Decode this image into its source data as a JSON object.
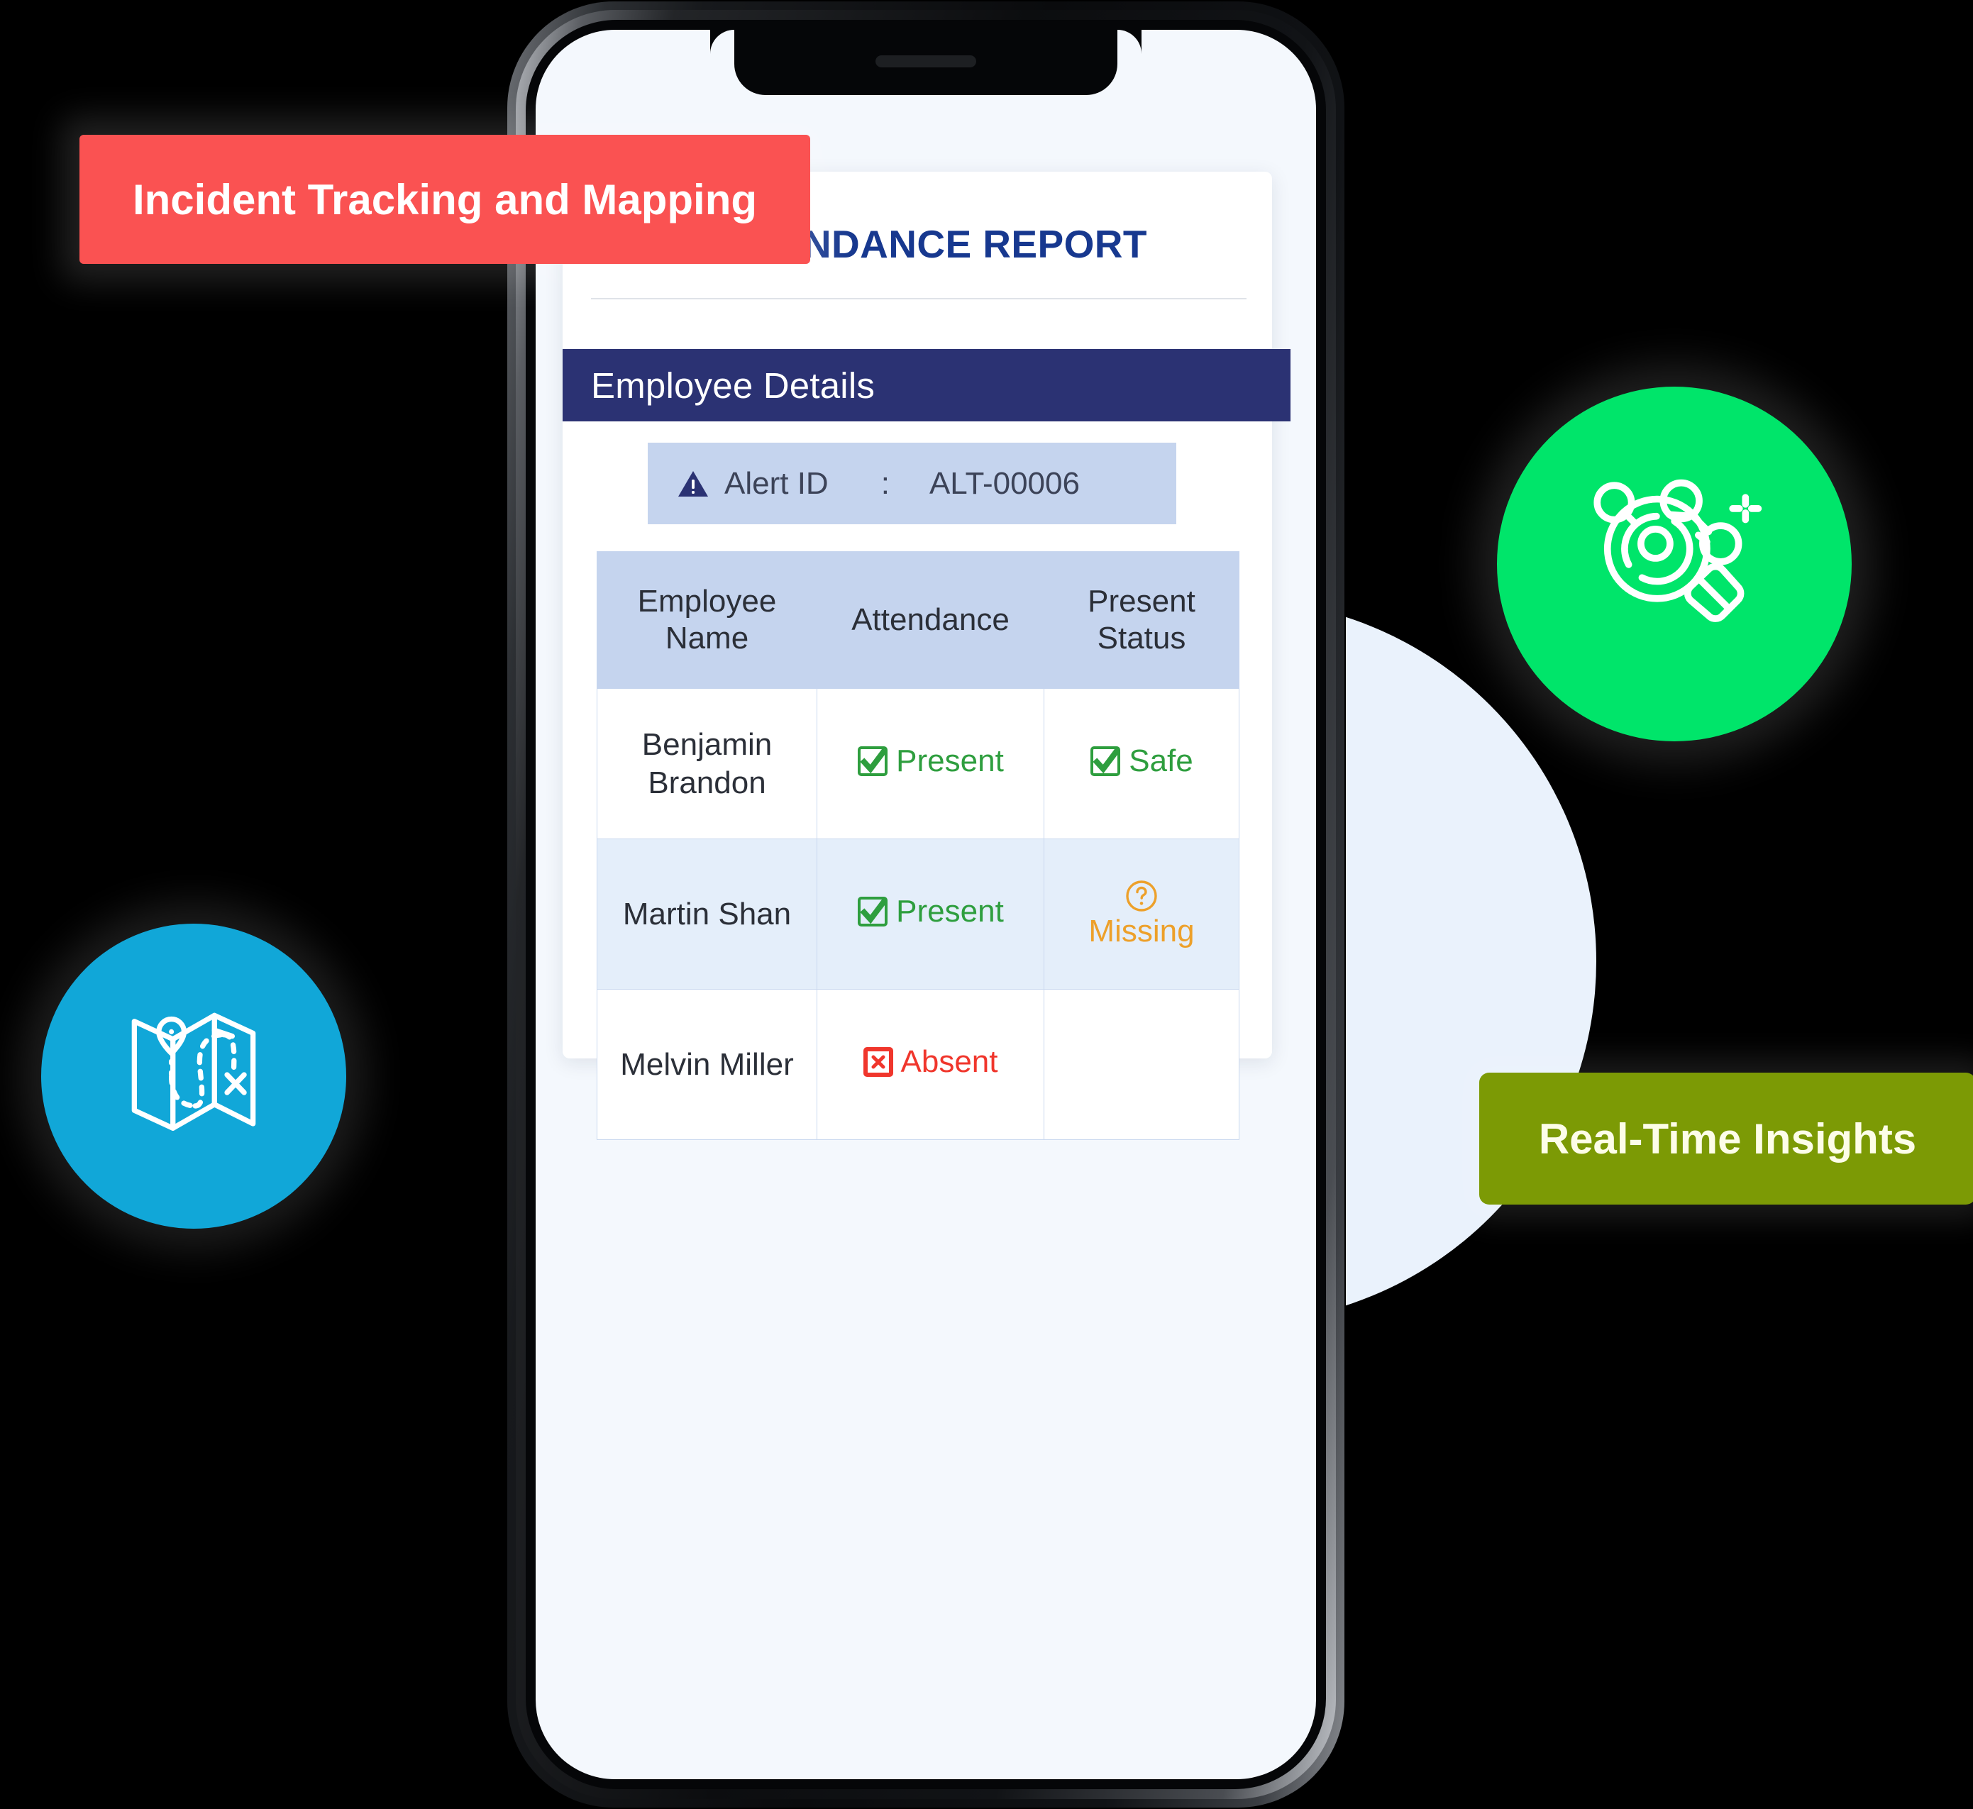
{
  "badges": {
    "incident": {
      "label": "Incident Tracking and Mapping",
      "color": "#fa5252"
    },
    "insights": {
      "label": "Real-Time Insights",
      "color": "#7c9a05"
    }
  },
  "chips": {
    "map": {
      "icon": "folded-map-route-icon",
      "color": "#11a7d8"
    },
    "insight": {
      "icon": "network-analysis-magnifier-icon",
      "color": "#00e56a"
    }
  },
  "phone": {
    "screen_background": "#f4f8fd",
    "frame_color": "#050608"
  },
  "app": {
    "page_title": "VIEW ATTENDANCE REPORT",
    "title_color": "#17388f",
    "section": {
      "label": "Employee Details",
      "background": "#2b3273"
    },
    "alert": {
      "icon": "warning-triangle-icon",
      "label": "Alert ID",
      "separator": ":",
      "value": "ALT-00006",
      "background": "#c5d4ee"
    },
    "table": {
      "header_background": "#c5d4ee",
      "row_alt_background": "#e4eefa",
      "columns": [
        "Employee Name",
        "Attendance",
        "Present Status"
      ],
      "rows": [
        {
          "name": "Benjamin Brandon",
          "attendance": {
            "text": "Present",
            "icon": "checkbox-checked-icon",
            "color": "#2e9e3e"
          },
          "status": {
            "text": "Safe",
            "icon": "checkbox-checked-icon",
            "color": "#2e9e3e"
          }
        },
        {
          "name": "Martin Shan",
          "attendance": {
            "text": "Present",
            "icon": "checkbox-checked-icon",
            "color": "#2e9e3e"
          },
          "status": {
            "text": "Missing",
            "icon": "question-circle-icon",
            "color": "#eda02a"
          }
        },
        {
          "name": "Melvin Miller",
          "attendance": {
            "text": "Absent",
            "icon": "cross-box-icon",
            "color": "#f0362c"
          },
          "status": {
            "text": "",
            "icon": "",
            "color": ""
          }
        }
      ]
    }
  }
}
